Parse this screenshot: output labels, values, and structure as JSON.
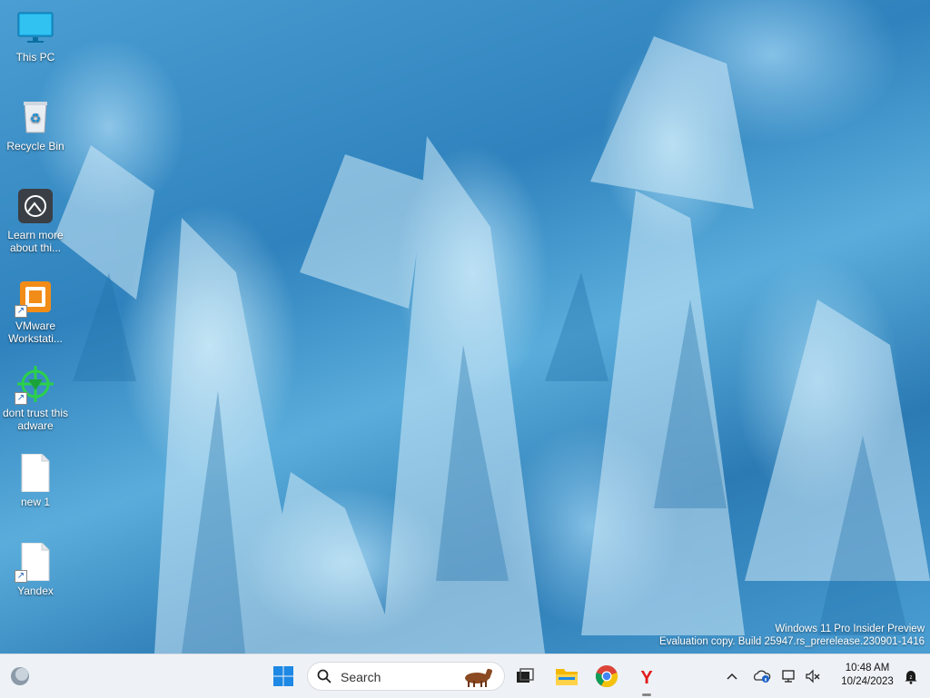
{
  "desktop": {
    "icons": [
      {
        "name": "this-pc",
        "label": "This PC",
        "icon": "monitor-icon"
      },
      {
        "name": "recycle-bin",
        "label": "Recycle Bin",
        "icon": "recycle-bin-icon"
      },
      {
        "name": "learn-more",
        "label": "Learn more about thi...",
        "icon": "learn-more-icon"
      },
      {
        "name": "vmware",
        "label": "VMware Workstati...",
        "icon": "vmware-icon"
      },
      {
        "name": "dont-trust",
        "label": "dont trust this adware",
        "icon": "crosshair-icon"
      },
      {
        "name": "new-1",
        "label": "new 1",
        "icon": "blank-file-icon"
      },
      {
        "name": "yandex",
        "label": "Yandex",
        "icon": "blank-file-icon"
      }
    ],
    "watermark": {
      "line1": "Windows 11 Pro Insider Preview",
      "line2": "Evaluation copy. Build 25947.rs_prerelease.230901-1416"
    }
  },
  "taskbar": {
    "search": {
      "placeholder": "Search"
    },
    "pinned": [
      "start-icon",
      "task-view-icon",
      "file-explorer-icon",
      "chrome-icon",
      "yandex-browser-icon"
    ],
    "clock": {
      "time": "10:48 AM",
      "date": "10/24/2023"
    }
  }
}
